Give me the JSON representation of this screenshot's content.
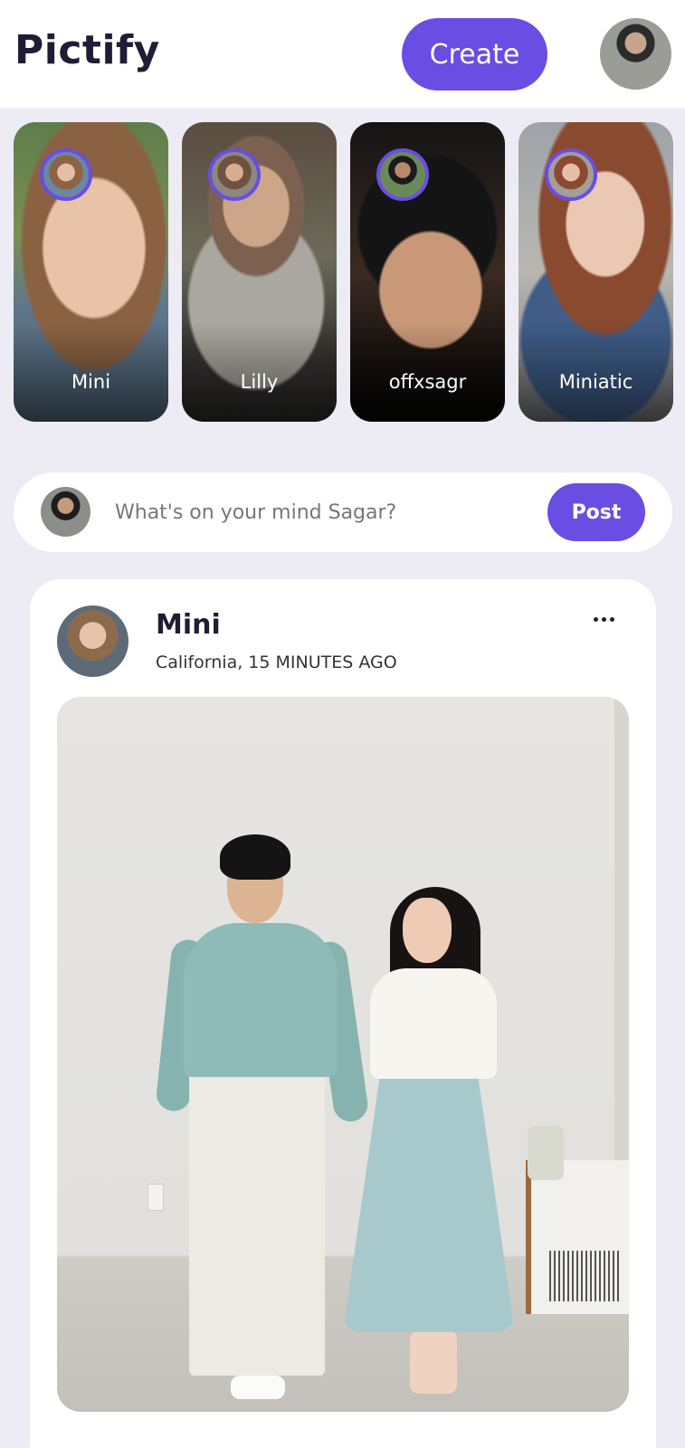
{
  "header": {
    "app_name": "Pictify",
    "create_label": "Create"
  },
  "stories": [
    {
      "name": "Mini"
    },
    {
      "name": "Lilly"
    },
    {
      "name": "offxsagr"
    },
    {
      "name": "Miniatic"
    }
  ],
  "compose": {
    "placeholder": "What's on your mind Sagar?",
    "post_label": "Post"
  },
  "feed": {
    "posts": [
      {
        "author": "Mini",
        "meta": "California, 15 MINUTES AGO"
      }
    ]
  },
  "colors": {
    "accent": "#6a4de3",
    "page_bg": "#edecf5",
    "text_dark": "#1f1d35"
  },
  "icons": [
    "more-options-icon"
  ]
}
